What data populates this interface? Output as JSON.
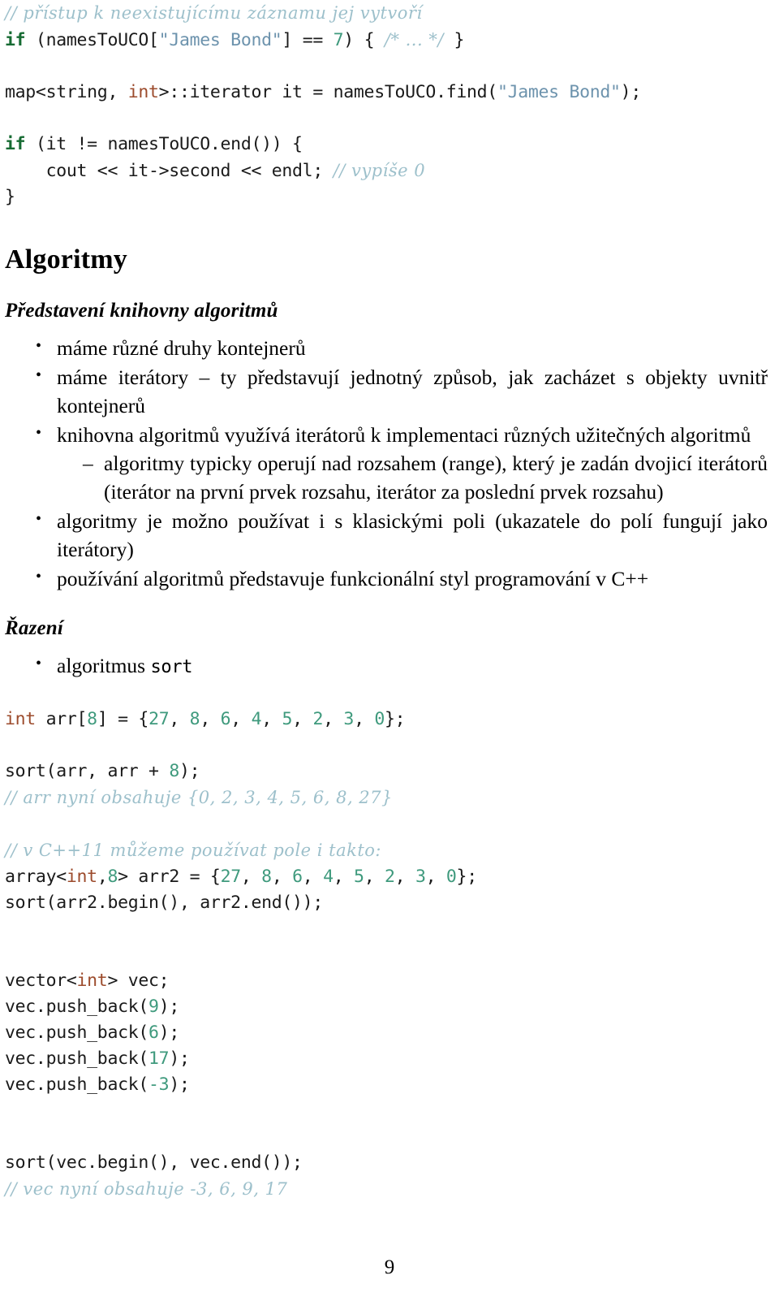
{
  "document": {
    "page_number": "9",
    "colors": {
      "comment": "#9dc0cb",
      "keyword": "#176b33",
      "type": "#9c4b2c",
      "string": "#6d93ad",
      "number": "#3f9a7d",
      "text": "#000000",
      "background": "#ffffff"
    }
  },
  "code_top": {
    "lines": [
      {
        "id": "l1",
        "tokens": [
          {
            "cls": "cmt",
            "t": "// přístup k neexistujícímu záznamu jej vytvoří"
          }
        ]
      },
      {
        "id": "l2",
        "tokens": [
          {
            "cls": "kw",
            "t": "if"
          },
          {
            "cls": "",
            "t": " (namesToUCO["
          },
          {
            "cls": "str",
            "t": "\"James Bond\""
          },
          {
            "cls": "",
            "t": "] == "
          },
          {
            "cls": "num",
            "t": "7"
          },
          {
            "cls": "",
            "t": ") { "
          },
          {
            "cls": "cmt",
            "t": "/* ... */"
          },
          {
            "cls": "",
            "t": " }"
          }
        ]
      },
      {
        "id": "l3",
        "blank": true
      },
      {
        "id": "l4",
        "tokens": [
          {
            "cls": "",
            "t": "map<string, "
          },
          {
            "cls": "typ",
            "t": "int"
          },
          {
            "cls": "",
            "t": ">::iterator it = namesToUCO.find("
          },
          {
            "cls": "str",
            "t": "\"James Bond\""
          },
          {
            "cls": "",
            "t": ");"
          }
        ]
      },
      {
        "id": "l5",
        "blank": true
      },
      {
        "id": "l6",
        "tokens": [
          {
            "cls": "kw",
            "t": "if"
          },
          {
            "cls": "",
            "t": " (it != namesToUCO.end()) {"
          }
        ]
      },
      {
        "id": "l7",
        "tokens": [
          {
            "cls": "",
            "t": "    cout << it->second << endl; "
          },
          {
            "cls": "cmt",
            "t": "// vypíše 0"
          }
        ]
      },
      {
        "id": "l8",
        "tokens": [
          {
            "cls": "",
            "t": "}"
          }
        ]
      }
    ]
  },
  "section": {
    "heading": "Algoritmy",
    "subheading_intro": "Představení knihovny algoritmů",
    "bullets_intro": [
      {
        "text": "máme různé druhy kontejnerů"
      },
      {
        "text": "máme iterátory – ty představují jednotný způsob, jak zacházet s objekty uvnitř kontejnerů"
      },
      {
        "text": "knihovna algoritmů využívá iterátorů k implementaci různých užitečných algoritmů",
        "sub": [
          "algoritmy typicky operují nad rozsahem (range), který je zadán dvojicí iterátorů (iterátor na první prvek rozsahu, iterátor za poslední prvek rozsahu)"
        ]
      },
      {
        "text": "algoritmy je možno používat i s klasickými poli (ukazatele do polí fungují jako iterátory)"
      },
      {
        "text": "používání algoritmů představuje funkcionální styl programování v C++"
      }
    ],
    "subheading_sorting": "Řazení",
    "bullets_sorting": [
      {
        "prefix": "algoritmus ",
        "code": "sort"
      }
    ]
  },
  "code_bottom": {
    "lines": [
      {
        "id": "b1",
        "tokens": [
          {
            "cls": "typ",
            "t": "int"
          },
          {
            "cls": "",
            "t": " arr["
          },
          {
            "cls": "num",
            "t": "8"
          },
          {
            "cls": "",
            "t": "] = {"
          },
          {
            "cls": "num",
            "t": "27"
          },
          {
            "cls": "",
            "t": ", "
          },
          {
            "cls": "num",
            "t": "8"
          },
          {
            "cls": "",
            "t": ", "
          },
          {
            "cls": "num",
            "t": "6"
          },
          {
            "cls": "",
            "t": ", "
          },
          {
            "cls": "num",
            "t": "4"
          },
          {
            "cls": "",
            "t": ", "
          },
          {
            "cls": "num",
            "t": "5"
          },
          {
            "cls": "",
            "t": ", "
          },
          {
            "cls": "num",
            "t": "2"
          },
          {
            "cls": "",
            "t": ", "
          },
          {
            "cls": "num",
            "t": "3"
          },
          {
            "cls": "",
            "t": ", "
          },
          {
            "cls": "num",
            "t": "0"
          },
          {
            "cls": "",
            "t": "};"
          }
        ]
      },
      {
        "id": "b2",
        "blank": true
      },
      {
        "id": "b3",
        "tokens": [
          {
            "cls": "",
            "t": "sort(arr, arr + "
          },
          {
            "cls": "num",
            "t": "8"
          },
          {
            "cls": "",
            "t": ");"
          }
        ]
      },
      {
        "id": "b4",
        "tokens": [
          {
            "cls": "cmt",
            "t": "// arr nyní obsahuje {0, 2, 3, 4, 5, 6, 8, 27}"
          }
        ]
      },
      {
        "id": "b5",
        "blank": true
      },
      {
        "id": "b6",
        "tokens": [
          {
            "cls": "cmt",
            "t": "// v C++11 můžeme používat pole i takto:"
          }
        ]
      },
      {
        "id": "b7",
        "tokens": [
          {
            "cls": "",
            "t": "array<"
          },
          {
            "cls": "typ",
            "t": "int"
          },
          {
            "cls": "",
            "t": ","
          },
          {
            "cls": "num",
            "t": "8"
          },
          {
            "cls": "",
            "t": "> arr2 = {"
          },
          {
            "cls": "num",
            "t": "27"
          },
          {
            "cls": "",
            "t": ", "
          },
          {
            "cls": "num",
            "t": "8"
          },
          {
            "cls": "",
            "t": ", "
          },
          {
            "cls": "num",
            "t": "6"
          },
          {
            "cls": "",
            "t": ", "
          },
          {
            "cls": "num",
            "t": "4"
          },
          {
            "cls": "",
            "t": ", "
          },
          {
            "cls": "num",
            "t": "5"
          },
          {
            "cls": "",
            "t": ", "
          },
          {
            "cls": "num",
            "t": "2"
          },
          {
            "cls": "",
            "t": ", "
          },
          {
            "cls": "num",
            "t": "3"
          },
          {
            "cls": "",
            "t": ", "
          },
          {
            "cls": "num",
            "t": "0"
          },
          {
            "cls": "",
            "t": "};"
          }
        ]
      },
      {
        "id": "b8",
        "tokens": [
          {
            "cls": "",
            "t": "sort(arr2.begin(), arr2.end());"
          }
        ]
      },
      {
        "id": "b9",
        "blank": true
      },
      {
        "id": "b10",
        "blank": true
      },
      {
        "id": "b11",
        "tokens": [
          {
            "cls": "",
            "t": "vector<"
          },
          {
            "cls": "typ",
            "t": "int"
          },
          {
            "cls": "",
            "t": "> vec;"
          }
        ]
      },
      {
        "id": "b12",
        "tokens": [
          {
            "cls": "",
            "t": "vec.push_back("
          },
          {
            "cls": "num",
            "t": "9"
          },
          {
            "cls": "",
            "t": ");"
          }
        ]
      },
      {
        "id": "b13",
        "tokens": [
          {
            "cls": "",
            "t": "vec.push_back("
          },
          {
            "cls": "num",
            "t": "6"
          },
          {
            "cls": "",
            "t": ");"
          }
        ]
      },
      {
        "id": "b14",
        "tokens": [
          {
            "cls": "",
            "t": "vec.push_back("
          },
          {
            "cls": "num",
            "t": "17"
          },
          {
            "cls": "",
            "t": ");"
          }
        ]
      },
      {
        "id": "b15",
        "tokens": [
          {
            "cls": "",
            "t": "vec.push_back("
          },
          {
            "cls": "num",
            "t": "-3"
          },
          {
            "cls": "",
            "t": ");"
          }
        ]
      },
      {
        "id": "b16",
        "blank": true
      },
      {
        "id": "b17",
        "blank": true
      },
      {
        "id": "b18",
        "tokens": [
          {
            "cls": "",
            "t": "sort(vec.begin(), vec.end());"
          }
        ]
      },
      {
        "id": "b19",
        "tokens": [
          {
            "cls": "cmt",
            "t": "// vec nyní obsahuje -3, 6, 9, 17"
          }
        ]
      }
    ]
  }
}
